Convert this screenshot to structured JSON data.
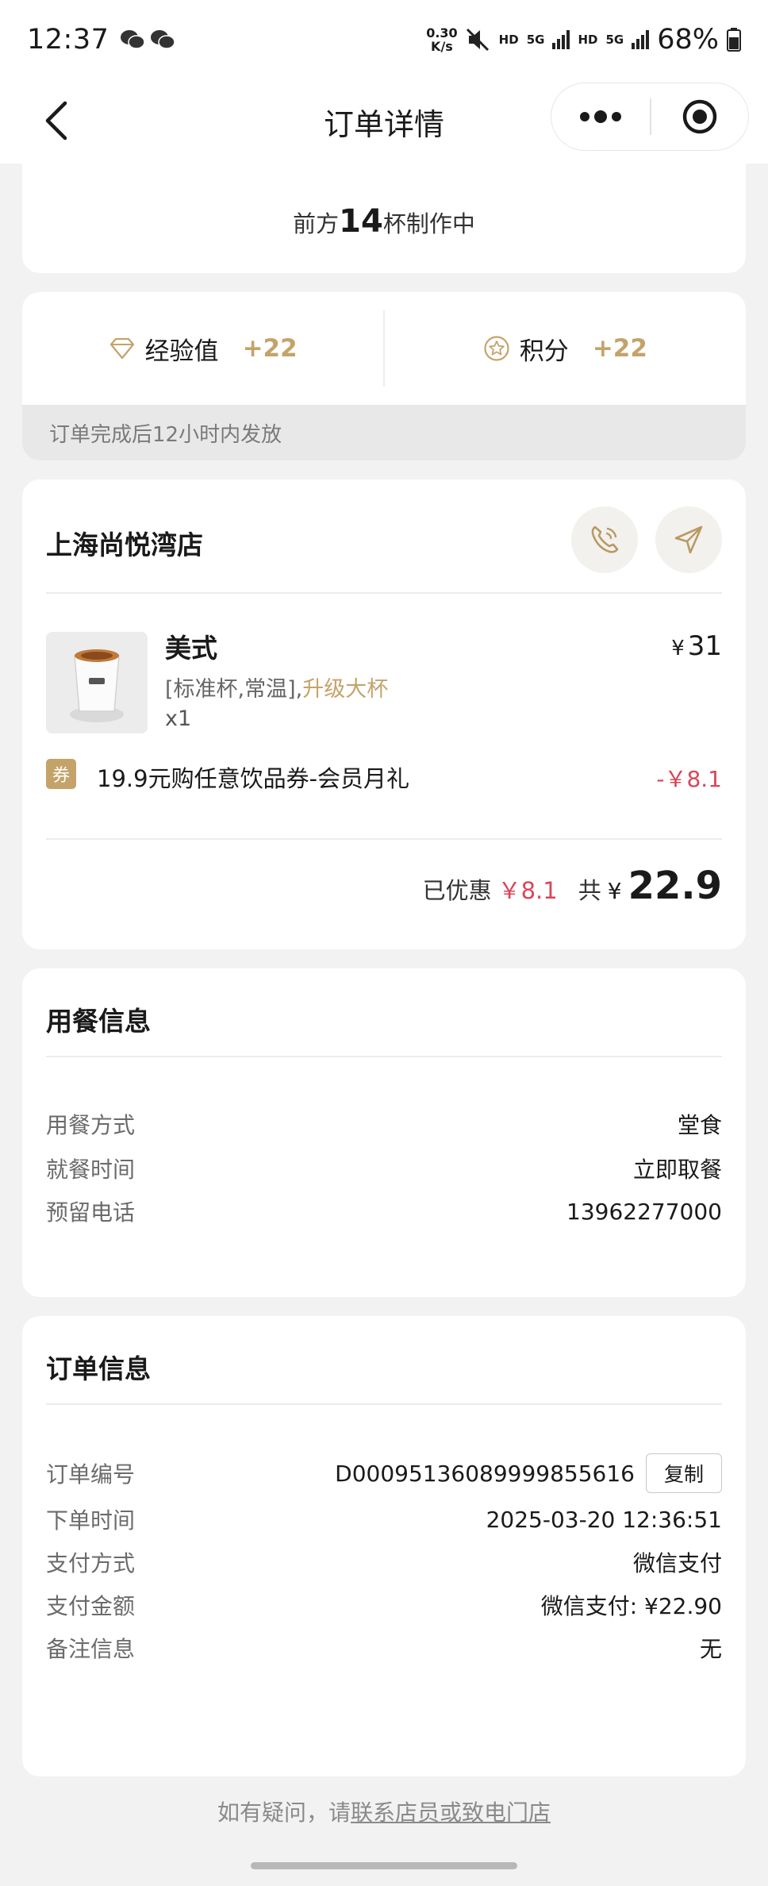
{
  "status_bar": {
    "time": "12:37",
    "net_speed_value": "0.30",
    "net_speed_unit": "K/s",
    "hd1": "HD",
    "sig1": "5G",
    "hd2": "HD",
    "sig2": "5G",
    "battery": "68%"
  },
  "nav": {
    "title": "订单详情"
  },
  "progress": {
    "prefix": "前方",
    "count": "14",
    "suffix": "杯制作中"
  },
  "rewards": {
    "exp_label": "经验值",
    "exp_value": "+22",
    "points_label": "积分",
    "points_value": "+22",
    "note": "订单完成后12小时内发放"
  },
  "store": {
    "name": "上海尚悦湾店"
  },
  "product": {
    "name": "美式",
    "spec_prefix": "[标准杯,常温],",
    "spec_upgrade": "升级大杯",
    "qty": "x1",
    "currency": "¥",
    "price": "31"
  },
  "coupon": {
    "tag": "券",
    "text": "19.9元购任意饮品券-会员月礼",
    "discount": "-￥8.1"
  },
  "total": {
    "discount_label": "已优惠",
    "discount_value": "￥8.1",
    "total_label": "共",
    "currency": "¥",
    "amount": "22.9"
  },
  "dining": {
    "title": "用餐信息",
    "rows": [
      {
        "key": "用餐方式",
        "value": "堂食"
      },
      {
        "key": "就餐时间",
        "value": "立即取餐"
      },
      {
        "key": "预留电话",
        "value": "13962277000"
      }
    ]
  },
  "order": {
    "title": "订单信息",
    "copy_label": "复制",
    "rows": [
      {
        "key": "订单编号",
        "value": "D0009513608999985561​6"
      },
      {
        "key": "下单时间",
        "value": "2025-03-20 12:36:51"
      },
      {
        "key": "支付方式",
        "value": "微信支付"
      },
      {
        "key": "支付金额",
        "value": "微信支付: ¥22.90"
      },
      {
        "key": "备注信息",
        "value": "无"
      }
    ]
  },
  "footer": {
    "prefix": "如有疑问，请",
    "link": "联系店员或致电门店"
  },
  "colors": {
    "accent_gold": "#c4a36a",
    "discount_red": "#d9455a",
    "background": "#f2f2f2"
  }
}
